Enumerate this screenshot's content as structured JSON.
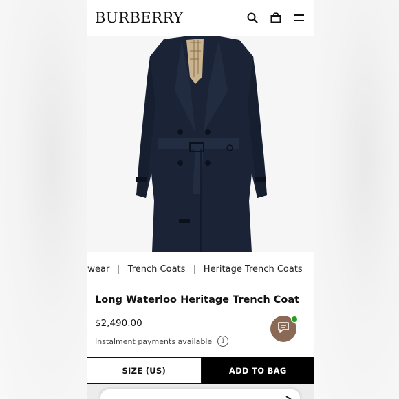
{
  "header": {
    "logo": "BURBERRY",
    "icons": [
      "search-icon",
      "bag-icon",
      "menu-icon"
    ]
  },
  "breadcrumb": {
    "items": [
      "Outerwear",
      "Trench Coats",
      "Heritage Trench Coats"
    ],
    "visible_first": "erwear"
  },
  "product": {
    "title": "Long Waterloo Heritage Trench Coat",
    "price": "$2,490.00",
    "instalment": "Instalment payments available",
    "info_icon": "i"
  },
  "actions": {
    "size_label": "SIZE (US)",
    "add_label": "ADD TO BAG"
  },
  "colors": {
    "coat": "#1b2437",
    "chat": "#8a6a55",
    "online": "#21a21a"
  }
}
